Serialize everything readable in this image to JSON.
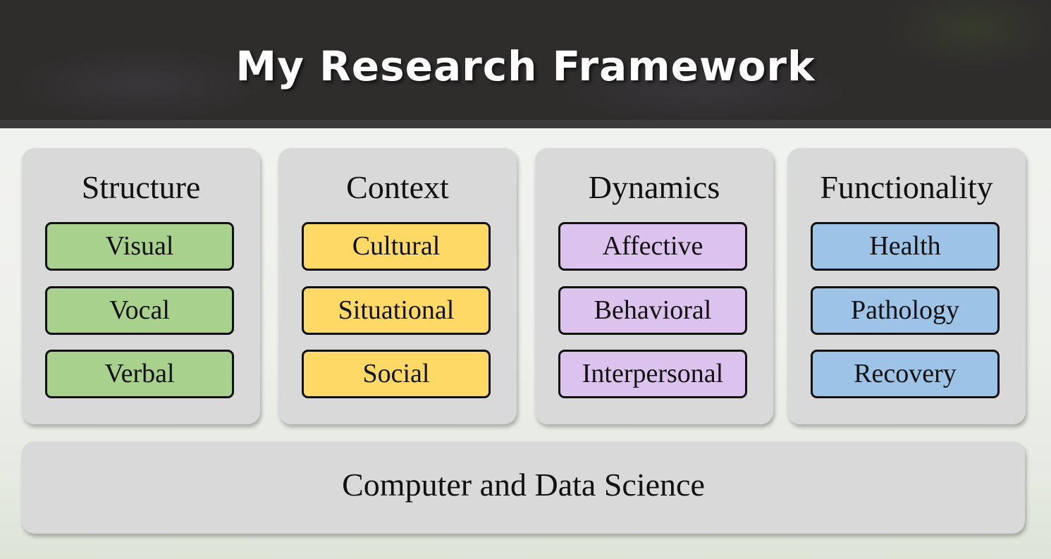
{
  "title": "My Research Framework",
  "columns": [
    {
      "heading": "Structure",
      "color": "#a9d18e",
      "items": [
        "Visual",
        "Vocal",
        "Verbal"
      ]
    },
    {
      "heading": "Context",
      "color": "#ffd966",
      "items": [
        "Cultural",
        "Situational",
        "Social"
      ]
    },
    {
      "heading": "Dynamics",
      "color": "#dcc3ee",
      "items": [
        "Affective",
        "Behavioral",
        "Interpersonal"
      ]
    },
    {
      "heading": "Functionality",
      "color": "#9dc3e6",
      "items": [
        "Health",
        "Pathology",
        "Recovery"
      ]
    }
  ],
  "foundation": "Computer and Data Science"
}
